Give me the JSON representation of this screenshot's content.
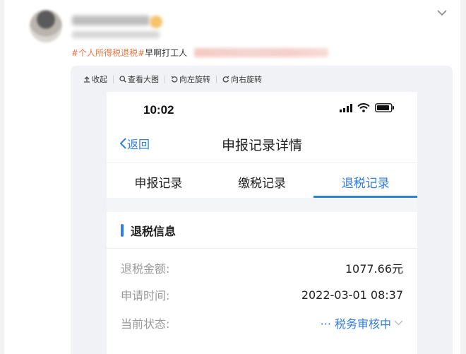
{
  "post": {
    "topic": "#个人所得税退税#",
    "text": "早啊打工人"
  },
  "image_toolbar": {
    "collapse": "收起",
    "view_large": "查看大图",
    "rotate_left": "向左旋转",
    "rotate_right": "向右旋转"
  },
  "phone": {
    "time": "10:02",
    "nav": {
      "back": "返回",
      "title": "申报记录详情"
    },
    "tabs": [
      {
        "label": "申报记录",
        "active": false
      },
      {
        "label": "缴税记录",
        "active": false
      },
      {
        "label": "退税记录",
        "active": true
      }
    ],
    "section_title": "退税信息",
    "rows": [
      {
        "label": "退税金额:",
        "value": "1077.66元"
      },
      {
        "label": "申请时间:",
        "value": "2022-03-01 08:37"
      },
      {
        "label": "当前状态:",
        "value": "··· 税务审核中"
      }
    ]
  },
  "colors": {
    "accent": "#2f7ee6",
    "topic": "#eb7340"
  }
}
